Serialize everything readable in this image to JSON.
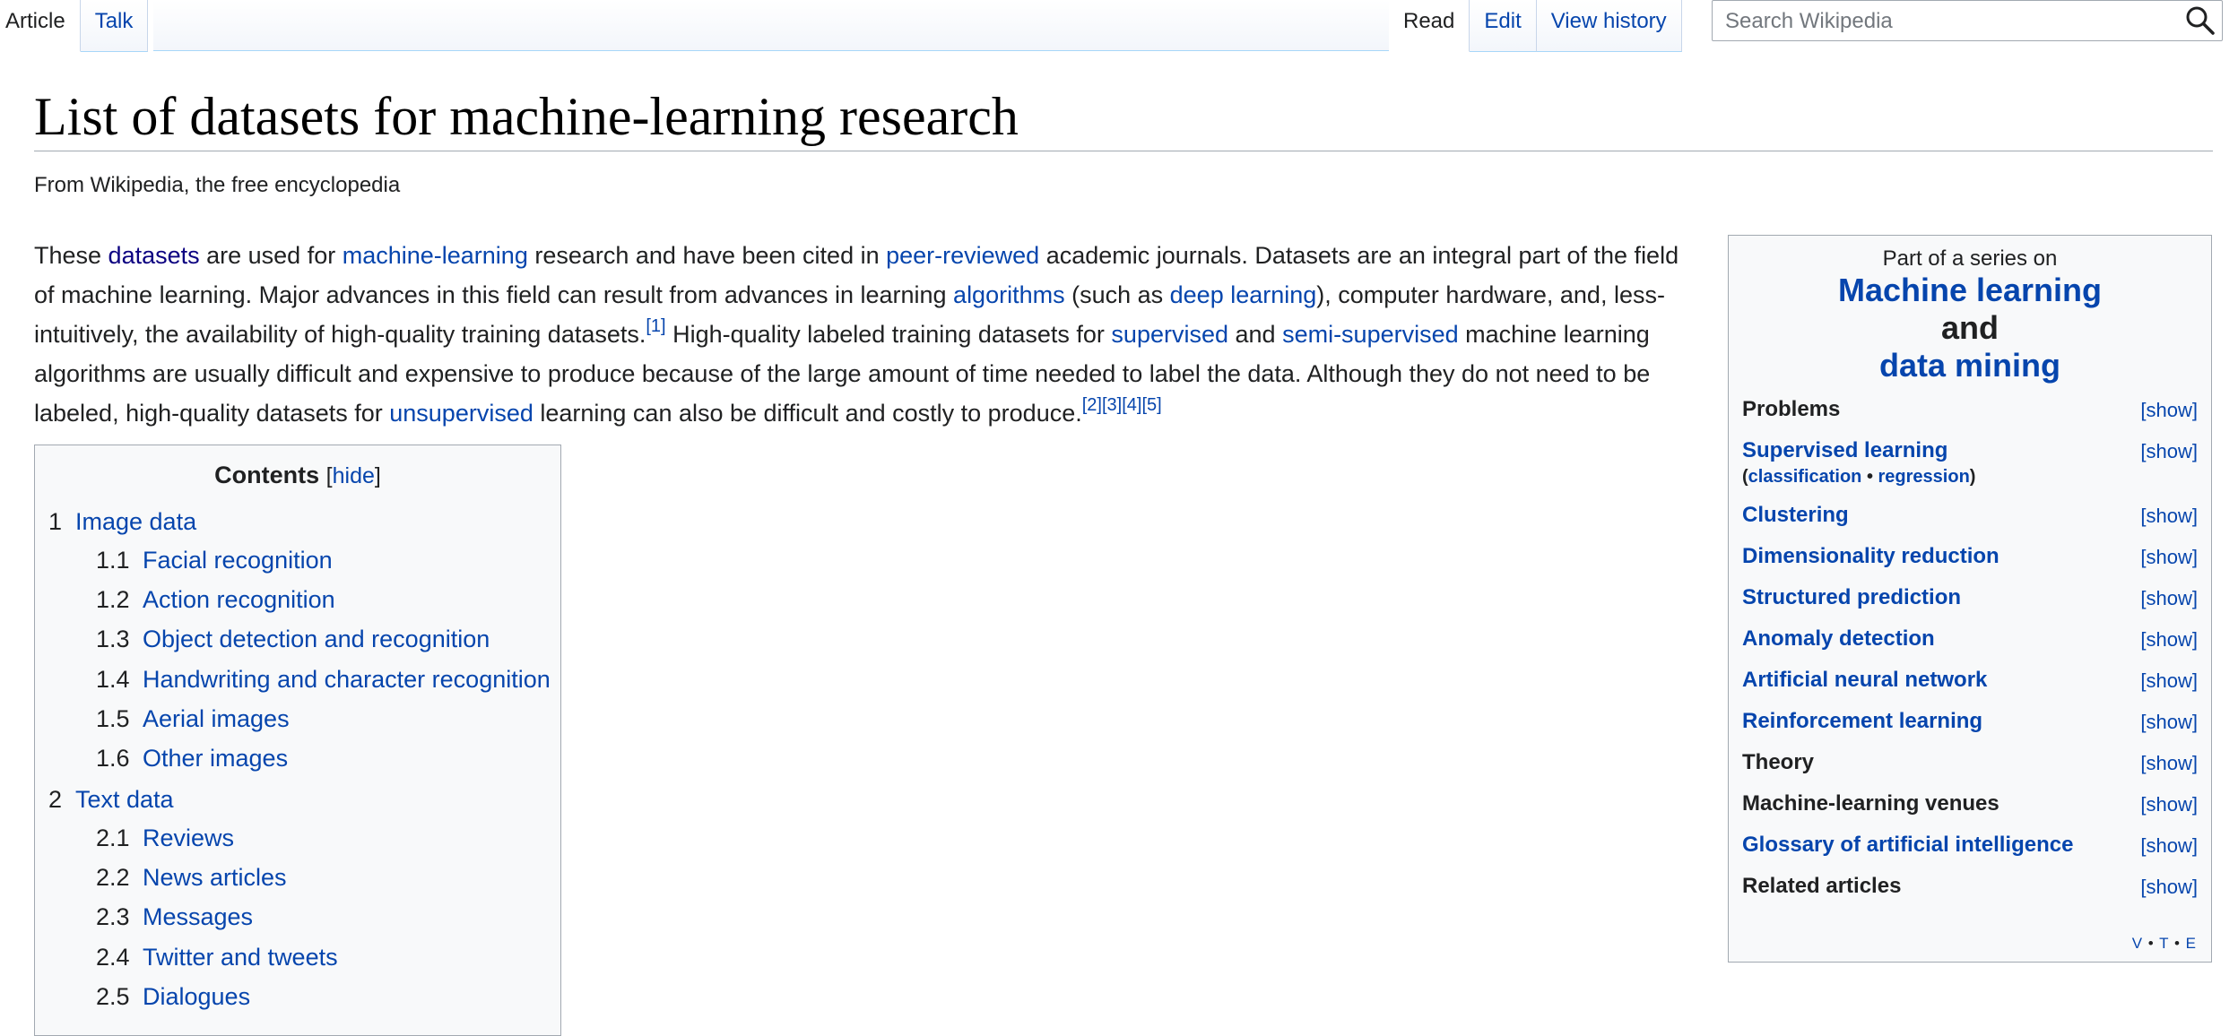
{
  "tabs": {
    "article": "Article",
    "talk": "Talk",
    "read": "Read",
    "edit": "Edit",
    "view_history": "View history"
  },
  "search": {
    "placeholder": "Search Wikipedia"
  },
  "page": {
    "title": "List of datasets for machine-learning research",
    "tagline": "From Wikipedia, the free encyclopedia"
  },
  "intro": {
    "t1": "These ",
    "l_datasets": "datasets",
    "t2": " are used for ",
    "l_ml": "machine-learning",
    "t3": " research and have been cited in ",
    "l_peer": "peer-reviewed",
    "t4": " academic journals. Datasets are an integral part of the field of machine learning. Major advances in this field can result from advances in learning ",
    "l_algorithms": "algorithms",
    "t5": " (such as ",
    "l_deep": "deep learning",
    "t6": "), computer hardware, and, less-intuitively, the availability of high-quality training datasets.",
    "ref1": "[1]",
    "t7": " High-quality labeled training datasets for ",
    "l_supervised": "supervised",
    "t8": " and ",
    "l_semi": "semi-supervised",
    "t9": " machine learning algorithms are usually difficult and expensive to produce because of the large amount of time needed to label the data. Although they do not need to be labeled, high-quality datasets for ",
    "l_unsupervised": "unsupervised",
    "t10": " learning can also be difficult and costly to produce.",
    "ref2": "[2]",
    "ref3": "[3]",
    "ref4": "[4]",
    "ref5": "[5]"
  },
  "toc": {
    "title": "Contents",
    "bracket_open": "[",
    "hide": "hide",
    "bracket_close": "]",
    "items": [
      {
        "num": "1",
        "label": "Image data"
      },
      {
        "num": "1.1",
        "label": "Facial recognition"
      },
      {
        "num": "1.2",
        "label": "Action recognition"
      },
      {
        "num": "1.3",
        "label": "Object detection and recognition"
      },
      {
        "num": "1.4",
        "label": "Handwriting and character recognition"
      },
      {
        "num": "1.5",
        "label": "Aerial images"
      },
      {
        "num": "1.6",
        "label": "Other images"
      },
      {
        "num": "2",
        "label": "Text data"
      },
      {
        "num": "2.1",
        "label": "Reviews"
      },
      {
        "num": "2.2",
        "label": "News articles"
      },
      {
        "num": "2.3",
        "label": "Messages"
      },
      {
        "num": "2.4",
        "label": "Twitter and tweets"
      },
      {
        "num": "2.5",
        "label": "Dialogues"
      }
    ]
  },
  "sidebar": {
    "above": "Part of a series on",
    "heading_link1": "Machine learning",
    "heading_and": "and",
    "heading_link2": "data mining",
    "show_label": "[show]",
    "rows": [
      {
        "label": "Problems"
      },
      {
        "label": "Supervised learning",
        "sub_open": "(",
        "sub_link1": "classification",
        "sub_sep": " • ",
        "sub_link2": "regression",
        "sub_close": ")"
      },
      {
        "label": "Clustering"
      },
      {
        "label": "Dimensionality reduction"
      },
      {
        "label": "Structured prediction"
      },
      {
        "label": "Anomaly detection"
      },
      {
        "label": "Artificial neural network"
      },
      {
        "label": "Reinforcement learning"
      },
      {
        "label": "Theory"
      },
      {
        "label": "Machine-learning venues"
      },
      {
        "label": "Glossary of artificial intelligence"
      },
      {
        "label": "Related articles"
      }
    ],
    "vte": {
      "v": "V",
      "t": "T",
      "e": "E",
      "dot": "•"
    }
  }
}
